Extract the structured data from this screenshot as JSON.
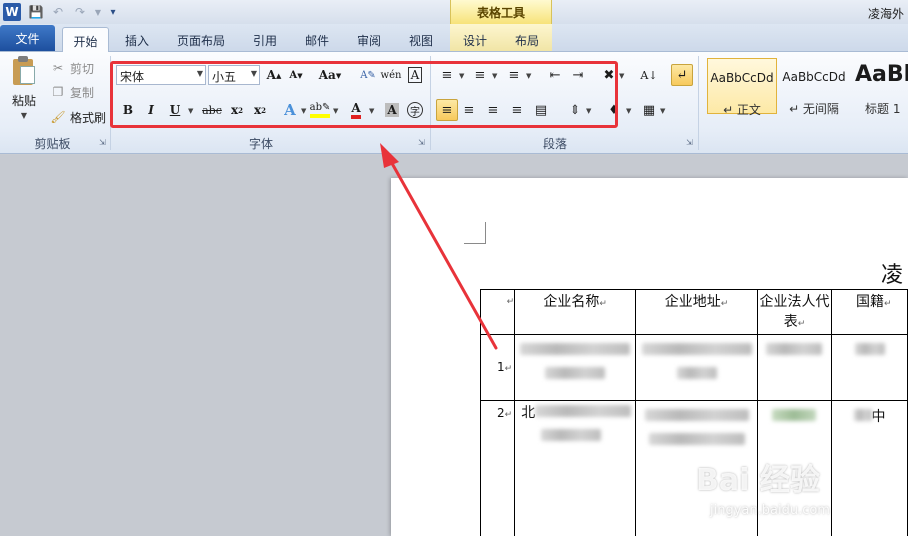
{
  "titlebar": {
    "app_icon_text": "W",
    "context_title": "表格工具",
    "document_title": "凌海外"
  },
  "tabs": [
    {
      "label": "文件"
    },
    {
      "label": "开始"
    },
    {
      "label": "插入"
    },
    {
      "label": "页面布局"
    },
    {
      "label": "引用"
    },
    {
      "label": "邮件"
    },
    {
      "label": "审阅"
    },
    {
      "label": "视图"
    },
    {
      "label": "设计"
    },
    {
      "label": "布局"
    }
  ],
  "clipboard": {
    "paste_label": "粘贴",
    "cut_label": "剪切",
    "copy_label": "复制",
    "format_painter_label": "格式刷",
    "group_label": "剪贴板"
  },
  "font": {
    "font_name": "宋体",
    "font_size": "小五",
    "group_label": "字体",
    "text_color": "#e02020",
    "highlight_color": "#ffff00"
  },
  "paragraph": {
    "group_label": "段落"
  },
  "styles": [
    {
      "sample": "AaBbCcDd",
      "name": "↵ 正文"
    },
    {
      "sample": "AaBbCcDd",
      "name": "↵ 无间隔"
    },
    {
      "sample": "AaBl",
      "name": "标题 1"
    }
  ],
  "document": {
    "heading": "凌",
    "table": {
      "headers": [
        "企业名称",
        "企业地址",
        "企业法人代表",
        "国籍"
      ],
      "rows": [
        {
          "number": "1"
        },
        {
          "number": "2",
          "first_char": "北",
          "last_char": "中"
        }
      ]
    }
  },
  "watermark": {
    "brand": "Bai 经验",
    "url": "jingyan.baidu.com"
  },
  "colors": {
    "highlight_box": "#e8333a",
    "file_tab": "#2a5aa8",
    "context_tab": "#f7e37a"
  }
}
